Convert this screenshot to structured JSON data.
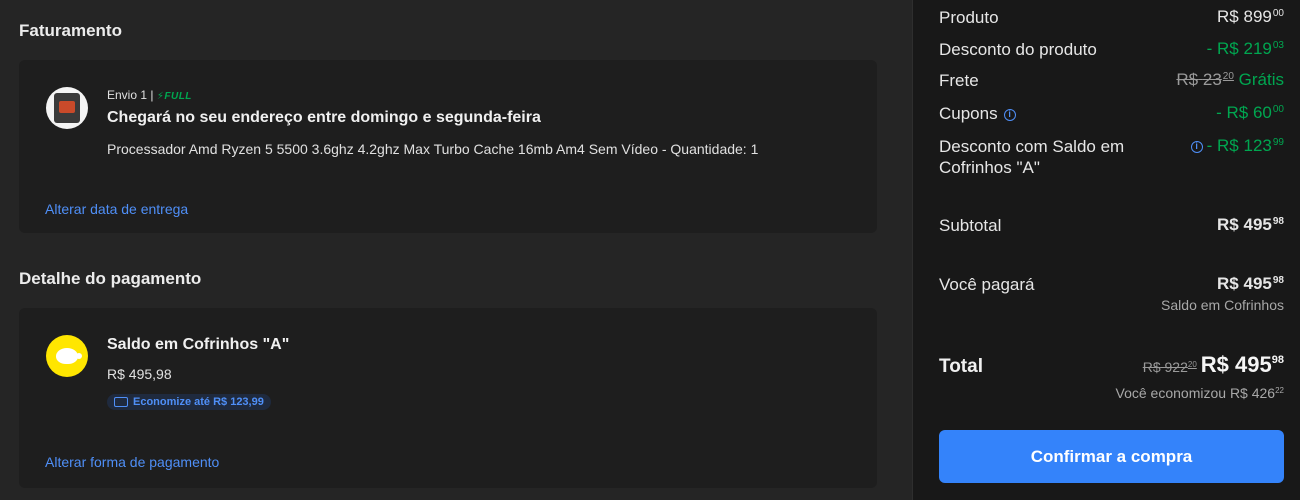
{
  "billing": {
    "title": "Faturamento",
    "shipment_label": "Envio 1 |",
    "full_label": "FULL",
    "heading": "Chegará no seu endereço entre domingo e segunda-feira",
    "product_line": "Processador Amd Ryzen 5 5500 3.6ghz 4.2ghz Max Turbo Cache 16mb Am4 Sem Vídeo - Quantidade: 1",
    "change_date_link": "Alterar data de entrega"
  },
  "payment": {
    "title": "Detalhe do pagamento",
    "method_name": "Saldo em Cofrinhos \"A\"",
    "amount": "R$ 495,98",
    "badge_text": "Economize até R$ 123,99",
    "change_method_link": "Alterar forma de pagamento"
  },
  "summary": {
    "product": {
      "label": "Produto",
      "currency": "R$",
      "value": "899",
      "cents": "00"
    },
    "product_discount": {
      "label": "Desconto do produto",
      "prefix": "- R$",
      "value": "219",
      "cents": "03"
    },
    "shipping": {
      "label": "Frete",
      "old_currency": "R$",
      "old_value": "23",
      "old_cents": "20",
      "free_label": "Grátis"
    },
    "coupons": {
      "label": "Cupons",
      "prefix": "- R$",
      "value": "60",
      "cents": "00"
    },
    "piggy_discount": {
      "label": "Desconto com Saldo em Cofrinhos \"A\"",
      "prefix": "- R$",
      "value": "123",
      "cents": "99"
    },
    "subtotal": {
      "label": "Subtotal",
      "currency": "R$",
      "value": "495",
      "cents": "98"
    },
    "you_pay": {
      "label": "Você pagará",
      "currency": "R$",
      "value": "495",
      "cents": "98",
      "note": "Saldo em Cofrinhos"
    },
    "total": {
      "label": "Total",
      "old_currency": "R$",
      "old_value": "922",
      "old_cents": "20",
      "currency": "R$",
      "value": "495",
      "cents": "98",
      "savings_label": "Você economizou R$",
      "savings_value": "426",
      "savings_cents": "22"
    },
    "confirm_button": "Confirmar a compra"
  },
  "colors": {
    "accent": "#3483fa",
    "discount_green": "#00a650",
    "link_blue": "#4f8ff7",
    "panel_bg": "#181818",
    "card_bg": "#1e1e1e"
  },
  "icons": [
    "lightning-icon",
    "info-icon",
    "coupon-icon",
    "piggy-bank-icon",
    "product-thumbnail"
  ]
}
